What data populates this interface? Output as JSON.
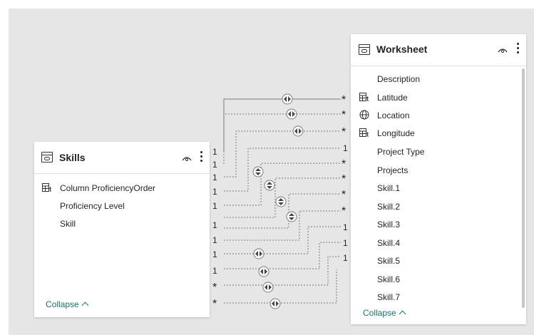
{
  "skills_table": {
    "name": "Skills",
    "fields": [
      {
        "label": "Column ProficiencyOrder",
        "icon": "hierarchy-icon"
      },
      {
        "label": "Proficiency Level",
        "icon": ""
      },
      {
        "label": "Skill",
        "icon": ""
      }
    ],
    "collapse_label": "Collapse"
  },
  "worksheet_table": {
    "name": "Worksheet",
    "fields": [
      {
        "label": "Description",
        "icon": ""
      },
      {
        "label": "Latitude",
        "icon": "hierarchy-icon"
      },
      {
        "label": "Location",
        "icon": "globe-icon"
      },
      {
        "label": "Longitude",
        "icon": "hierarchy-icon"
      },
      {
        "label": "Project Type",
        "icon": ""
      },
      {
        "label": "Projects",
        "icon": ""
      },
      {
        "label": "Skill.1",
        "icon": ""
      },
      {
        "label": "Skill.2",
        "icon": ""
      },
      {
        "label": "Skill.3",
        "icon": ""
      },
      {
        "label": "Skill.4",
        "icon": ""
      },
      {
        "label": "Skill.5",
        "icon": ""
      },
      {
        "label": "Skill.6",
        "icon": ""
      },
      {
        "label": "Skill.7",
        "icon": ""
      }
    ],
    "collapse_label": "Collapse"
  },
  "relationships": {
    "skills_side": [
      "1",
      "1",
      "1",
      "1",
      "1",
      "1",
      "1",
      "1",
      "1",
      "*",
      "*"
    ],
    "worksheet_side": [
      "*",
      "*",
      "*",
      "1",
      "*",
      "*",
      "*",
      "*",
      "1",
      "1",
      "1"
    ],
    "colors": {
      "line": "#7a7a7a",
      "accent": "#117865"
    }
  }
}
